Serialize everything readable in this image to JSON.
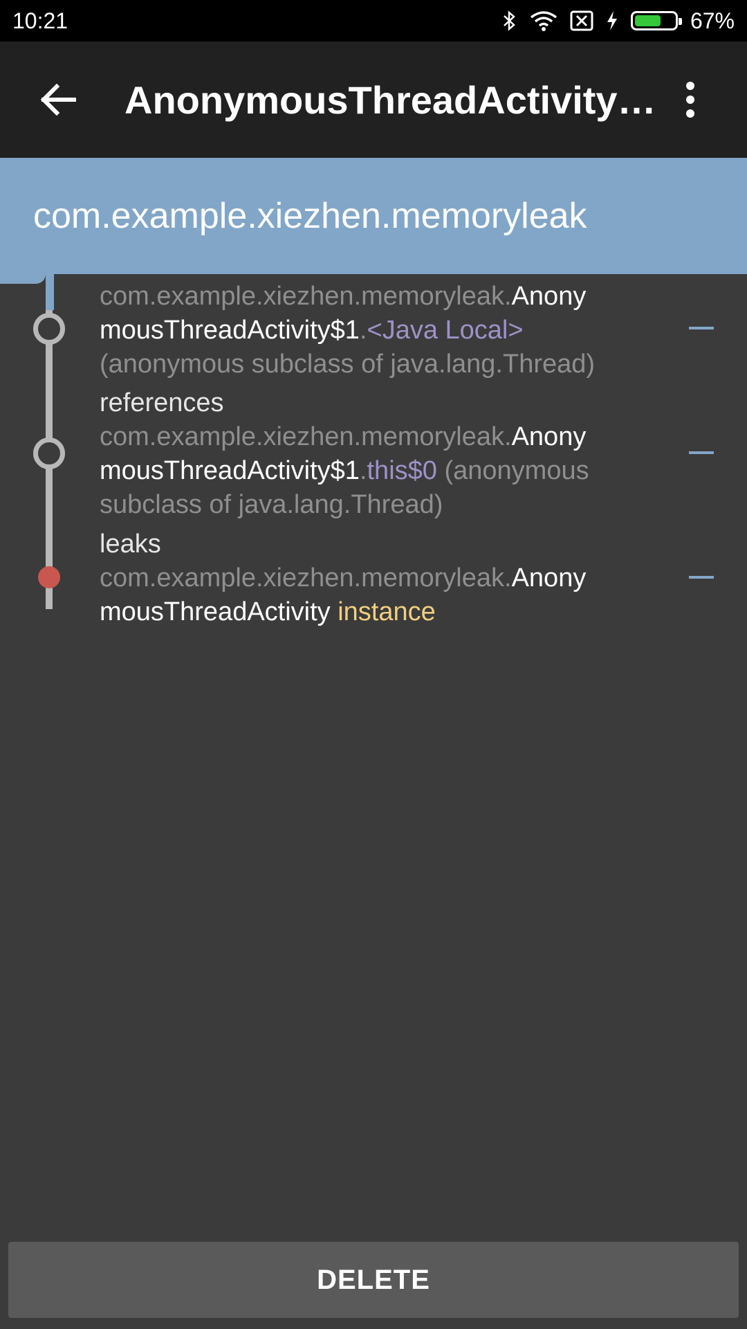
{
  "status_bar": {
    "time": "10:21",
    "battery_percent_text": "67%",
    "battery_level": 0.67,
    "icons": [
      "bluetooth-icon",
      "wifi-icon",
      "no-sim-icon",
      "charging-icon",
      "battery-icon"
    ]
  },
  "toolbar": {
    "title": "AnonymousThreadActivity…",
    "back_icon": "arrow-left-icon",
    "menu_icon": "more-vertical-icon"
  },
  "header": {
    "package": "com.example.xiezhen.memoryleak"
  },
  "trace": [
    {
      "prefix": "com.example.xiezhen.memoryleak.",
      "class_a": "Anony",
      "class_b": "mousThreadActivity$1",
      "dot": ".",
      "field": "<Java Local>",
      "detail": "(anonymous subclass of java.lang.Thread)"
    },
    {
      "relation": "references",
      "prefix": "com.example.xiezhen.memoryleak.",
      "class_a": "Anony",
      "class_b": "mousThreadActivity$1",
      "dot": ".",
      "field": "this$0",
      "detail_a": "(anonymous",
      "detail_b": "subclass of java.lang.Thread)"
    },
    {
      "relation": "leaks",
      "prefix": "com.example.xiezhen.memoryleak.",
      "class_a": "Anony",
      "class_b": "mousThreadActivity",
      "suffix": "instance"
    }
  ],
  "footer": {
    "delete_label": "DELETE"
  },
  "colors": {
    "header_bg": "#82a6c7",
    "leak_dot": "#c9574f",
    "field_purple": "#9e92c7",
    "instance_yellow": "#f1cf80"
  }
}
